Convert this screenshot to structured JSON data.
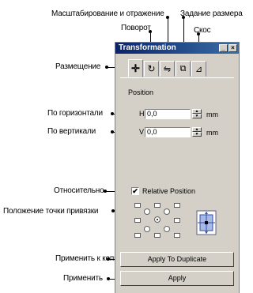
{
  "callouts": {
    "scale_mirror": "Масштабирование и отражение",
    "rotate": "Поворот",
    "size": "Задание размера",
    "skew": "Скос",
    "position": "Размещение",
    "horizontal": "По горизонтали",
    "vertical": "По вертикали",
    "relative": "Относительно",
    "anchor": "Положение точки привязки",
    "apply_duplicate": "Применить к копии",
    "apply": "Применить"
  },
  "panel": {
    "title": "Transformation",
    "minimize_glyph": "_",
    "close_glyph": "×",
    "section_label": "Position",
    "h_label": "H",
    "h_value": "0,0",
    "v_label": "V",
    "v_value": "0,0",
    "unit": "mm",
    "relative_checked_glyph": "✔",
    "relative_label": "Relative Position",
    "apply_duplicate_label": "Apply To Duplicate",
    "apply_label": "Apply",
    "spin_up": "▲",
    "spin_down": "▼"
  },
  "tabs": [
    {
      "icon": "move-icon",
      "glyph": "✛"
    },
    {
      "icon": "rotate-icon",
      "glyph": "↻"
    },
    {
      "icon": "scale-icon",
      "glyph": "⇋"
    },
    {
      "icon": "size-icon",
      "glyph": "⧉"
    },
    {
      "icon": "skew-icon",
      "glyph": "⊿"
    }
  ],
  "colors": {
    "titlebar_start": "#0a246a",
    "titlebar_end": "#3a6ea5",
    "panel_bg": "#d4d0c8"
  }
}
